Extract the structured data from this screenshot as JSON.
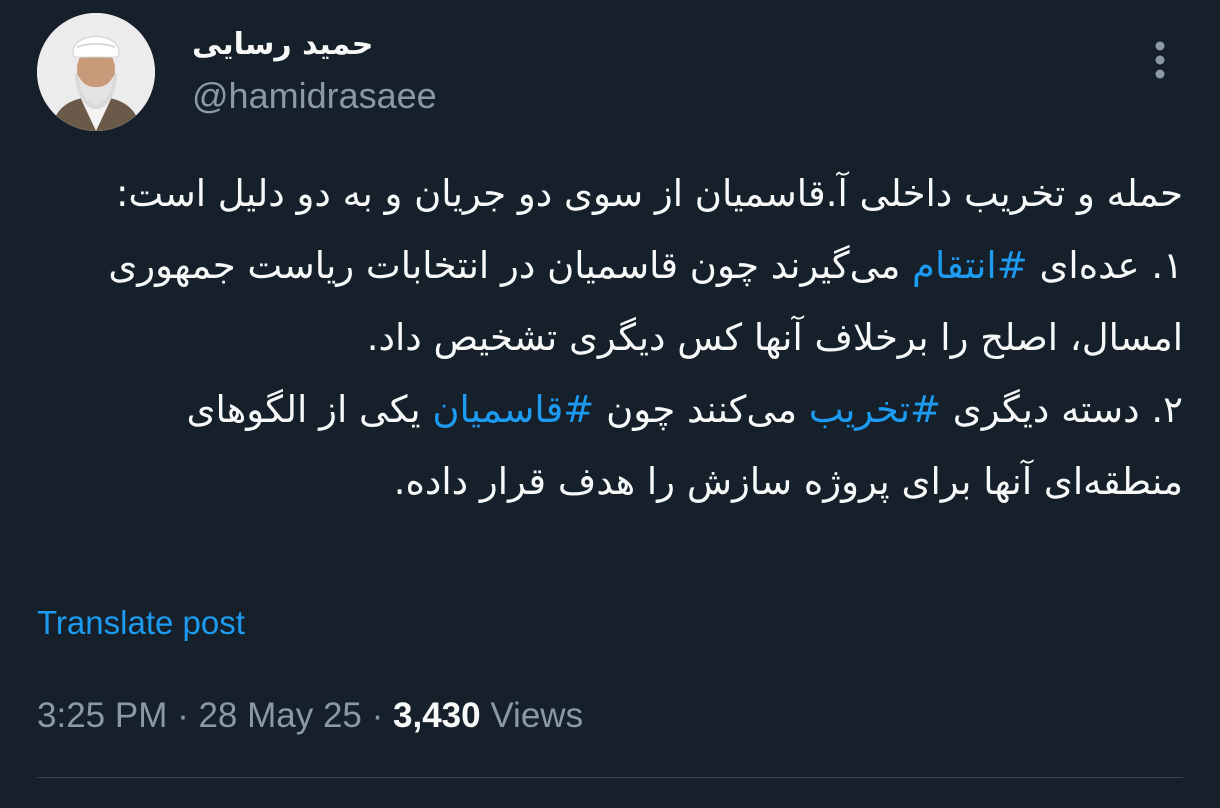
{
  "author": {
    "display_name": "حمید رسایی",
    "handle": "@hamidrasaee",
    "avatar_icon": "user-avatar-photo"
  },
  "tweet": {
    "intro": "حمله و تخریب داخلی آ.قاسمیان از سوی دو جریان و به دو دلیل است:",
    "p1_pre": "۱. عده‌ای ",
    "p1_tag": "#انتقام",
    "p1_post": " می‌گیرند چون قاسمیان در انتخابات ریاست جمهوری امسال، اصلح را برخلاف آنها کس دیگری تشخیص داد.",
    "p2_pre": "۲. دسته دیگری ",
    "p2_tag1": "#تخریب",
    "p2_mid": " می‌کنند چون ",
    "p2_tag2": "#قاسمیان",
    "p2_post": " یکی از الگوهای منطقه‌ای آنها برای پروژه سازش را هدف قرار داده."
  },
  "translate_label": "Translate post",
  "meta": {
    "time": "3:25 PM",
    "separator": " · ",
    "date": "28 May 25",
    "views_count": "3,430",
    "views_label": " Views"
  },
  "colors": {
    "background": "#15202b",
    "text": "#f7f9f9",
    "secondary": "#8b98a5",
    "accent": "#1d9bf0",
    "divider": "#38444d"
  },
  "icons": {
    "more": "more-vertical-icon"
  }
}
